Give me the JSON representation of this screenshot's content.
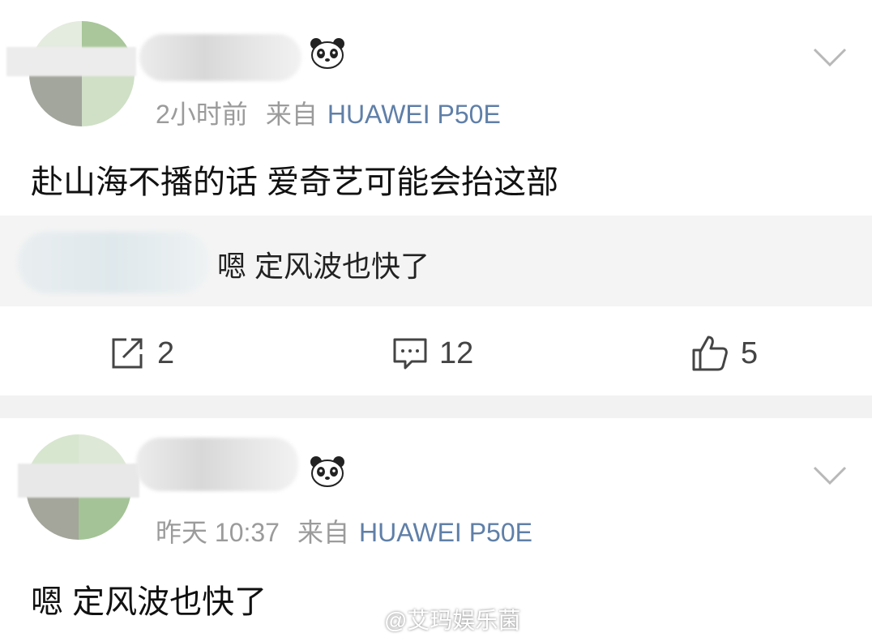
{
  "posts": [
    {
      "time": "2小时前",
      "source_prefix": "来自",
      "device": "HUAWEI P50E",
      "content": "赴山海不播的话 爱奇艺可能会抬这部",
      "quote": "嗯 定风波也快了",
      "actions": {
        "repost_count": "2",
        "comment_count": "12",
        "like_count": "5"
      }
    },
    {
      "time": "昨天 10:37",
      "source_prefix": "来自",
      "device": "HUAWEI P50E",
      "content": "嗯 定风波也快了"
    }
  ],
  "watermark": "@艾玛娱乐菌",
  "icons": [
    "panda-badge-icon",
    "chevron-down-icon",
    "repost-icon",
    "comment-icon",
    "like-icon",
    "weibo-icon"
  ],
  "colors": {
    "device_link": "#5f7fa8",
    "meta_gray": "#9b9b9b",
    "divider": "#f2f2f2",
    "quote_bg": "#f4f4f4"
  }
}
